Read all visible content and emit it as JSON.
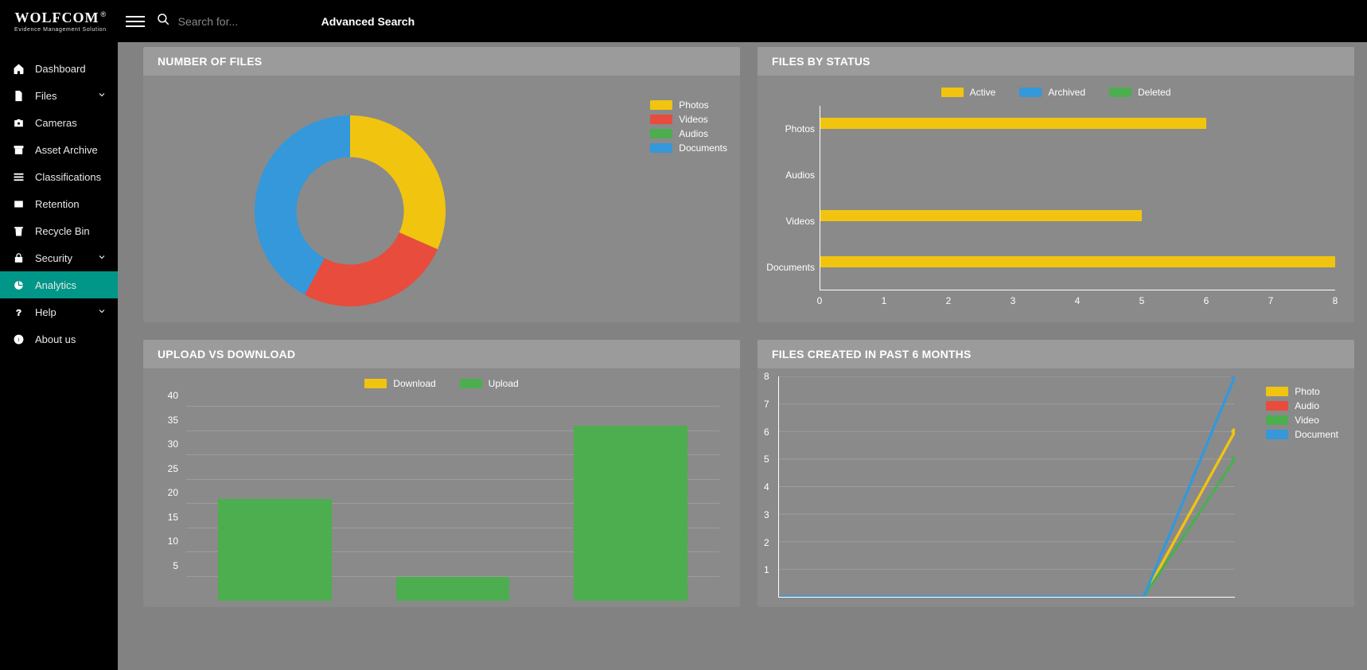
{
  "brand": {
    "name": "WOLFCOM",
    "tagline": "Evidence Management Solution",
    "reg": "®"
  },
  "search": {
    "placeholder": "Search for...",
    "advanced_label": "Advanced Search"
  },
  "colors": {
    "yellow": "#f1c40f",
    "red": "#e74c3c",
    "green": "#4cae4e",
    "blue": "#3498db",
    "teal": "#009688"
  },
  "sidebar": {
    "items": [
      {
        "label": "Dashboard",
        "icon": "home-icon",
        "expandable": false
      },
      {
        "label": "Files",
        "icon": "file-icon",
        "expandable": true
      },
      {
        "label": "Cameras",
        "icon": "camera-icon",
        "expandable": false
      },
      {
        "label": "Asset Archive",
        "icon": "archive-icon",
        "expandable": false
      },
      {
        "label": "Classifications",
        "icon": "list-icon",
        "expandable": false
      },
      {
        "label": "Retention",
        "icon": "retention-icon",
        "expandable": false
      },
      {
        "label": "Recycle Bin",
        "icon": "trash-icon",
        "expandable": false
      },
      {
        "label": "Security",
        "icon": "lock-icon",
        "expandable": true
      },
      {
        "label": "Analytics",
        "icon": "analytics-icon",
        "expandable": false,
        "active": true
      },
      {
        "label": "Help",
        "icon": "help-icon",
        "expandable": true
      },
      {
        "label": "About us",
        "icon": "info-icon",
        "expandable": false
      }
    ]
  },
  "cards": {
    "number_of_files": {
      "title": "NUMBER OF FILES"
    },
    "files_by_status": {
      "title": "FILES BY STATUS"
    },
    "upload_vs_download": {
      "title": "UPLOAD VS DOWNLOAD"
    },
    "files_created_6mo": {
      "title": "FILES CREATED IN PAST 6 MONTHS"
    }
  },
  "chart_data": [
    {
      "id": "number_of_files",
      "type": "pie",
      "donut": true,
      "legend_position": "right",
      "series": [
        {
          "name": "Photos",
          "value": 30,
          "color": "#f1c40f"
        },
        {
          "name": "Videos",
          "value": 25,
          "color": "#e74c3c"
        },
        {
          "name": "Audios",
          "value": 0,
          "color": "#4cae4e"
        },
        {
          "name": "Documents",
          "value": 40,
          "color": "#3498db"
        }
      ]
    },
    {
      "id": "files_by_status",
      "type": "bar",
      "orientation": "horizontal",
      "categories": [
        "Photos",
        "Audios",
        "Videos",
        "Documents"
      ],
      "x_ticks": [
        0,
        1,
        2,
        3,
        4,
        5,
        6,
        7,
        8
      ],
      "xlim": [
        0,
        8
      ],
      "series": [
        {
          "name": "Active",
          "color": "#f1c40f",
          "values": [
            6,
            0,
            5,
            8
          ]
        },
        {
          "name": "Archived",
          "color": "#3498db",
          "values": [
            0,
            0,
            0,
            0
          ]
        },
        {
          "name": "Deleted",
          "color": "#4cae4e",
          "values": [
            0,
            0,
            0,
            0
          ]
        }
      ]
    },
    {
      "id": "upload_vs_download",
      "type": "bar",
      "orientation": "vertical",
      "categories": [
        "",
        "",
        ""
      ],
      "y_ticks": [
        5,
        10,
        15,
        20,
        25,
        30,
        35,
        40
      ],
      "ylim": [
        0,
        40
      ],
      "series": [
        {
          "name": "Download",
          "color": "#f1c40f",
          "values": [
            0,
            0,
            0
          ]
        },
        {
          "name": "Upload",
          "color": "#4cae4e",
          "values": [
            21,
            5,
            36
          ]
        }
      ]
    },
    {
      "id": "files_created_6mo",
      "type": "line",
      "x": [
        0,
        1,
        2,
        3,
        4,
        5
      ],
      "y_ticks": [
        1,
        2,
        3,
        4,
        5,
        6,
        7,
        8
      ],
      "ylim": [
        0,
        8
      ],
      "series": [
        {
          "name": "Photo",
          "color": "#f1c40f",
          "values": [
            0,
            0,
            0,
            0,
            0,
            6
          ]
        },
        {
          "name": "Audio",
          "color": "#e74c3c",
          "values": [
            0,
            0,
            0,
            0,
            0,
            0
          ]
        },
        {
          "name": "Video",
          "color": "#4cae4e",
          "values": [
            0,
            0,
            0,
            0,
            0,
            5
          ]
        },
        {
          "name": "Document",
          "color": "#3498db",
          "values": [
            0,
            0,
            0,
            0,
            0,
            8
          ]
        }
      ]
    }
  ]
}
